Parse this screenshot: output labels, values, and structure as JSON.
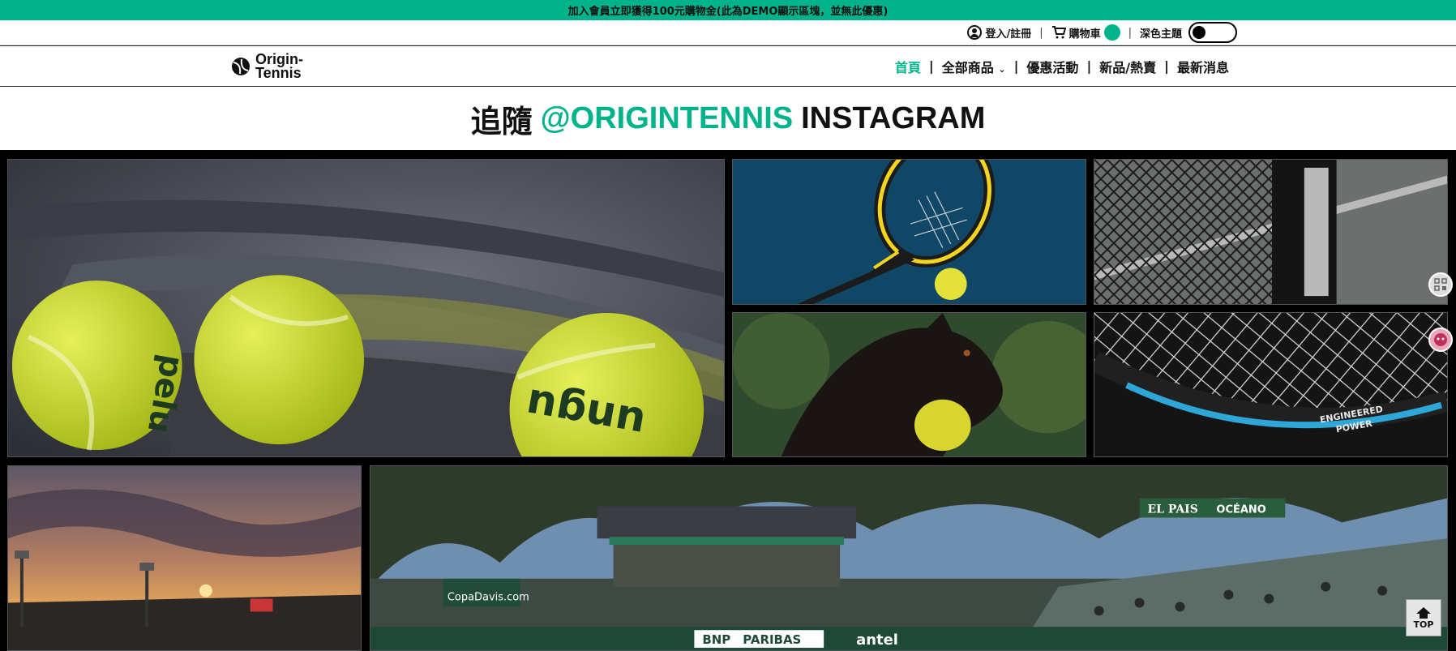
{
  "promo_bar": {
    "text": "加入會員立即獲得100元購物金(此為DEMO顯示區塊，並無此優惠)"
  },
  "utility_bar": {
    "login_label": "登入/註冊",
    "cart_label": "購物車",
    "theme_label": "深色主題",
    "login_icon": "user-circle-icon",
    "cart_icon": "cart-icon"
  },
  "logo": {
    "line1": "Origin-",
    "line2": "Tennis"
  },
  "nav": {
    "items": [
      {
        "label": "首頁",
        "active": true
      },
      {
        "label": "全部商品",
        "dropdown": true
      },
      {
        "label": "優惠活動"
      },
      {
        "label": "新品/熱賣"
      },
      {
        "label": "最新消息"
      }
    ]
  },
  "section": {
    "title_prefix": "追隨",
    "title_accent": "@ORIGINTENNIS",
    "title_suffix": "INSTAGRAM"
  },
  "gallery": {
    "tiles": [
      {
        "subject": "tennis balls on rackets"
      },
      {
        "subject": "racket and ball on blue court"
      },
      {
        "subject": "tennis net on clay"
      },
      {
        "subject": "dog holding tennis ball"
      },
      {
        "subject": "racket strings close-up"
      },
      {
        "subject": "stadium at sunset"
      },
      {
        "subject": "Copa Davis court with spectators"
      }
    ],
    "signs": {
      "copa": "CopaDavis.com",
      "bnp": "BNP",
      "paribas": "PARIBAS",
      "antel": "antel",
      "elpais": "EL PAIS",
      "oceano": "OCÉANO",
      "engineered": "ENGINEERED",
      "power": "POWER",
      "ball_text_1": "pelu",
      "ball_text_2": "ungu"
    }
  },
  "top_button": {
    "label": "TOP"
  },
  "colors": {
    "accent": "#00b38a",
    "overlay": "#000000"
  }
}
